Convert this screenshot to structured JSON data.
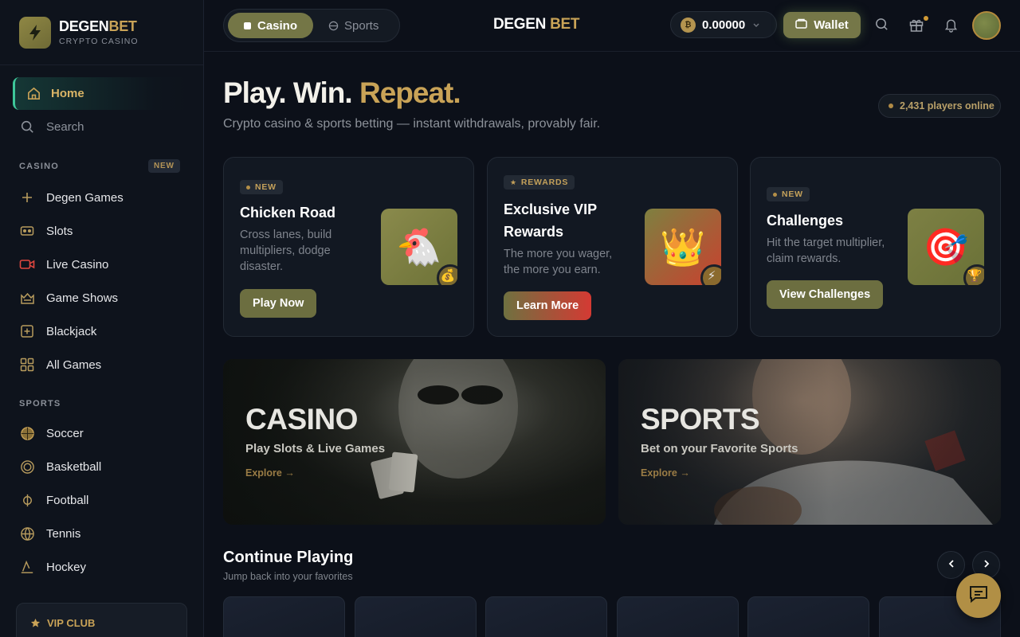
{
  "brand": {
    "name_white": "DEGEN",
    "name_gold": "BET",
    "subtitle": "CRYPTO CASINO"
  },
  "sidebar": {
    "home": "Home",
    "search": "Search",
    "casino_section": "CASINO",
    "casino_badge": "NEW",
    "casino_items": [
      {
        "label": "Degen Games",
        "icon": "plus-icon"
      },
      {
        "label": "Slots",
        "icon": "slot-machine-icon"
      },
      {
        "label": "Live Casino",
        "icon": "video-camera-icon"
      },
      {
        "label": "Game Shows",
        "icon": "crown-basket-icon"
      },
      {
        "label": "Blackjack",
        "icon": "card-plus-icon"
      },
      {
        "label": "All Games",
        "icon": "grid-icon"
      }
    ],
    "sports_section": "SPORTS",
    "sports_items": [
      {
        "label": "Soccer",
        "icon": "soccer-ball-icon"
      },
      {
        "label": "Basketball",
        "icon": "basketball-icon"
      },
      {
        "label": "Football",
        "icon": "football-icon"
      },
      {
        "label": "Tennis",
        "icon": "tennis-ball-icon"
      },
      {
        "label": "Hockey",
        "icon": "hockey-stick-icon"
      }
    ],
    "vip_club": "VIP CLUB"
  },
  "topbar": {
    "tab_casino": "Casino",
    "tab_sports": "Sports",
    "logo_white": "DEGEN",
    "logo_gold": "BET",
    "balance": "0.00000",
    "coin_symbol": "₿",
    "wallet": "Wallet"
  },
  "hero": {
    "title_white": "Play. Win.",
    "title_gold": "Repeat.",
    "subtitle": "Crypto casino & sports betting — instant withdrawals, provably fair.",
    "players_online": "2,431 players online"
  },
  "promos": [
    {
      "tag": "NEW",
      "title": "Chicken Road",
      "desc": "Cross lanes, build multipliers, dodge disaster.",
      "button": "Play Now",
      "art": "🐔",
      "mini": "💰"
    },
    {
      "tag": "REWARDS",
      "title": "Exclusive VIP Rewards",
      "desc": "The more you wager, the more you earn.",
      "button": "Learn More",
      "art": "👑",
      "mini": "⚡"
    },
    {
      "tag": "NEW",
      "title": "Challenges",
      "desc": "Hit the target multiplier, claim rewards.",
      "button": "View Challenges",
      "art": "🎯",
      "mini": "🏆"
    }
  ],
  "banners": [
    {
      "title": "CASINO",
      "subtitle": "Play Slots & Live Games",
      "explore": "Explore →"
    },
    {
      "title": "SPORTS",
      "subtitle": "Bet on your Favorite Sports",
      "explore": "Explore →"
    }
  ],
  "continue_playing": {
    "title": "Continue Playing",
    "subtitle": "Jump back into your favorites"
  },
  "colors": {
    "accent_gold": "#c9a357",
    "olive_button": "#747646",
    "teal_active": "#3ec79a",
    "background": "#0c1019"
  }
}
